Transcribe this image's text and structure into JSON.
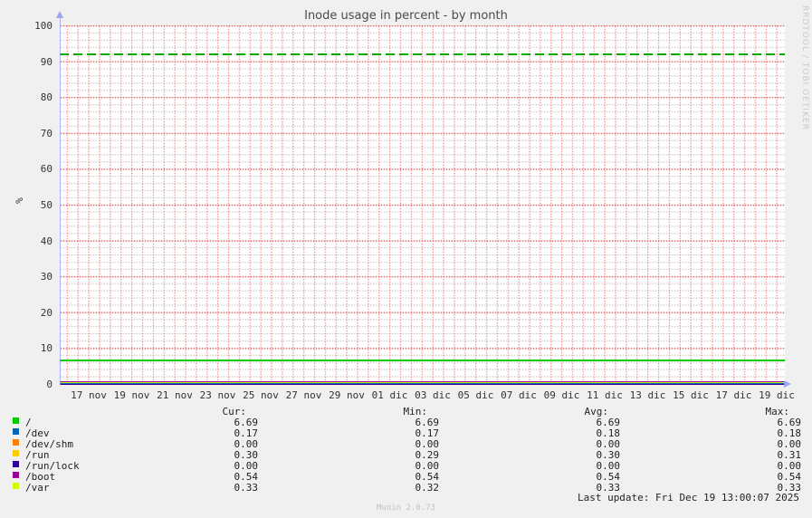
{
  "page": {
    "title": "Inode usage in percent - by month",
    "watermark": "RRDTOOL / TOBI OETIKER",
    "last_update": "Last update: Fri Dec 19 13:00:07 2025",
    "version": "Munin 2.0.73"
  },
  "chart_data": {
    "type": "line",
    "title": "Inode usage in percent - by month",
    "ylabel": "%",
    "ylim": [
      0,
      100
    ],
    "y_ticks": [
      0,
      10,
      20,
      30,
      40,
      50,
      60,
      70,
      80,
      90,
      100
    ],
    "x_ticks": [
      "17 nov",
      "19 nov",
      "21 nov",
      "23 nov",
      "25 nov",
      "27 nov",
      "29 nov",
      "01 dic",
      "03 dic",
      "05 dic",
      "07 dic",
      "09 dic",
      "11 dic",
      "13 dic",
      "15 dic",
      "17 dic",
      "19 dic"
    ],
    "grid": true,
    "legend_position": "bottom",
    "limit_line": {
      "value": 92,
      "style": "dashed",
      "color": "#00A800"
    },
    "legend_headers": [
      "Cur:",
      "Min:",
      "Avg:",
      "Max:"
    ],
    "series": [
      {
        "name": "/",
        "color": "#00CC00",
        "value": 6.69,
        "cur": "6.69",
        "min": "6.69",
        "avg": "6.69",
        "max": "6.69"
      },
      {
        "name": "/dev",
        "color": "#0066B3",
        "value": 0.17,
        "cur": "0.17",
        "min": "0.17",
        "avg": "0.18",
        "max": "0.18"
      },
      {
        "name": "/dev/shm",
        "color": "#FF8000",
        "value": 0.0,
        "cur": "0.00",
        "min": "0.00",
        "avg": "0.00",
        "max": "0.00"
      },
      {
        "name": "/run",
        "color": "#FFCC00",
        "value": 0.3,
        "cur": "0.30",
        "min": "0.29",
        "avg": "0.30",
        "max": "0.31"
      },
      {
        "name": "/run/lock",
        "color": "#330099",
        "value": 0.0,
        "cur": "0.00",
        "min": "0.00",
        "avg": "0.00",
        "max": "0.00"
      },
      {
        "name": "/boot",
        "color": "#990099",
        "value": 0.54,
        "cur": "0.54",
        "min": "0.54",
        "avg": "0.54",
        "max": "0.54"
      },
      {
        "name": "/var",
        "color": "#CCFF00",
        "value": 0.33,
        "cur": "0.33",
        "min": "0.32",
        "avg": "0.33",
        "max": "0.33"
      }
    ]
  }
}
